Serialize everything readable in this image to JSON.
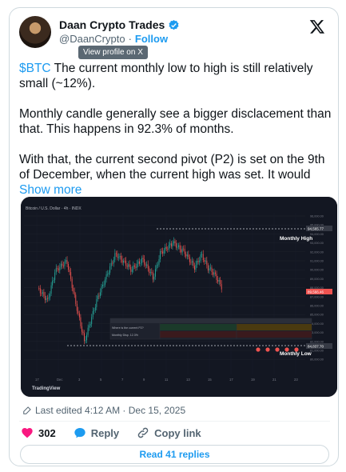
{
  "author": {
    "name": "Daan Crypto Trades",
    "handle": "@DaanCrypto",
    "follow_label": "Follow",
    "separator": "·",
    "tooltip": "View profile on X"
  },
  "tweet": {
    "cashtag": "$BTC",
    "line1_rest": " The current monthly low to high is still relatively small (~12%).",
    "para2": "Monthly candle generally see a bigger disclacement than that. This happens in 92.3% of months.",
    "para3": "With that, the current second pivot (P2) is set on the 9th of December, when the current high was set. It would",
    "show_more": "Show more"
  },
  "chart": {
    "header": "Bitcoin / U.S. Dollar · 4h · INDX",
    "monthly_high_label": "Monthly High",
    "monthly_low_label": "Monthly Low",
    "price_tag": "89,566.46",
    "high_tag": "94,565.77",
    "low_tag": "84,837.70",
    "branding": "TradingView",
    "price_axis": [
      "96,000.00",
      "95,000.00",
      "94,000.00",
      "93,000.00",
      "92,000.00",
      "91,000.00",
      "90,000.00",
      "89,000.00",
      "88,000.00",
      "87,000.00",
      "86,000.00",
      "85,000.00",
      "84,000.00",
      "83,000.00",
      "82,000.00",
      "81,000.00",
      "80,000.00"
    ],
    "time_axis": [
      "17",
      "Dec",
      "3",
      "5",
      "7",
      "9",
      "11",
      "13",
      "15",
      "17",
      "19",
      "21",
      "23"
    ],
    "table": {
      "row1": [
        "Where is the current P2?",
        "",
        "",
        ""
      ],
      "row2": [
        "Monthly Disp. 12.3%",
        "",
        "",
        ""
      ]
    },
    "colors": {
      "up": "#26a69a",
      "down": "#ef5350",
      "bg": "#131722"
    }
  },
  "meta": {
    "edited": "Last edited 4:12 AM · Dec 15, 2025"
  },
  "actions": {
    "likes": "302",
    "reply": "Reply",
    "copy_link": "Copy link"
  },
  "read_replies": "Read 41 replies"
}
